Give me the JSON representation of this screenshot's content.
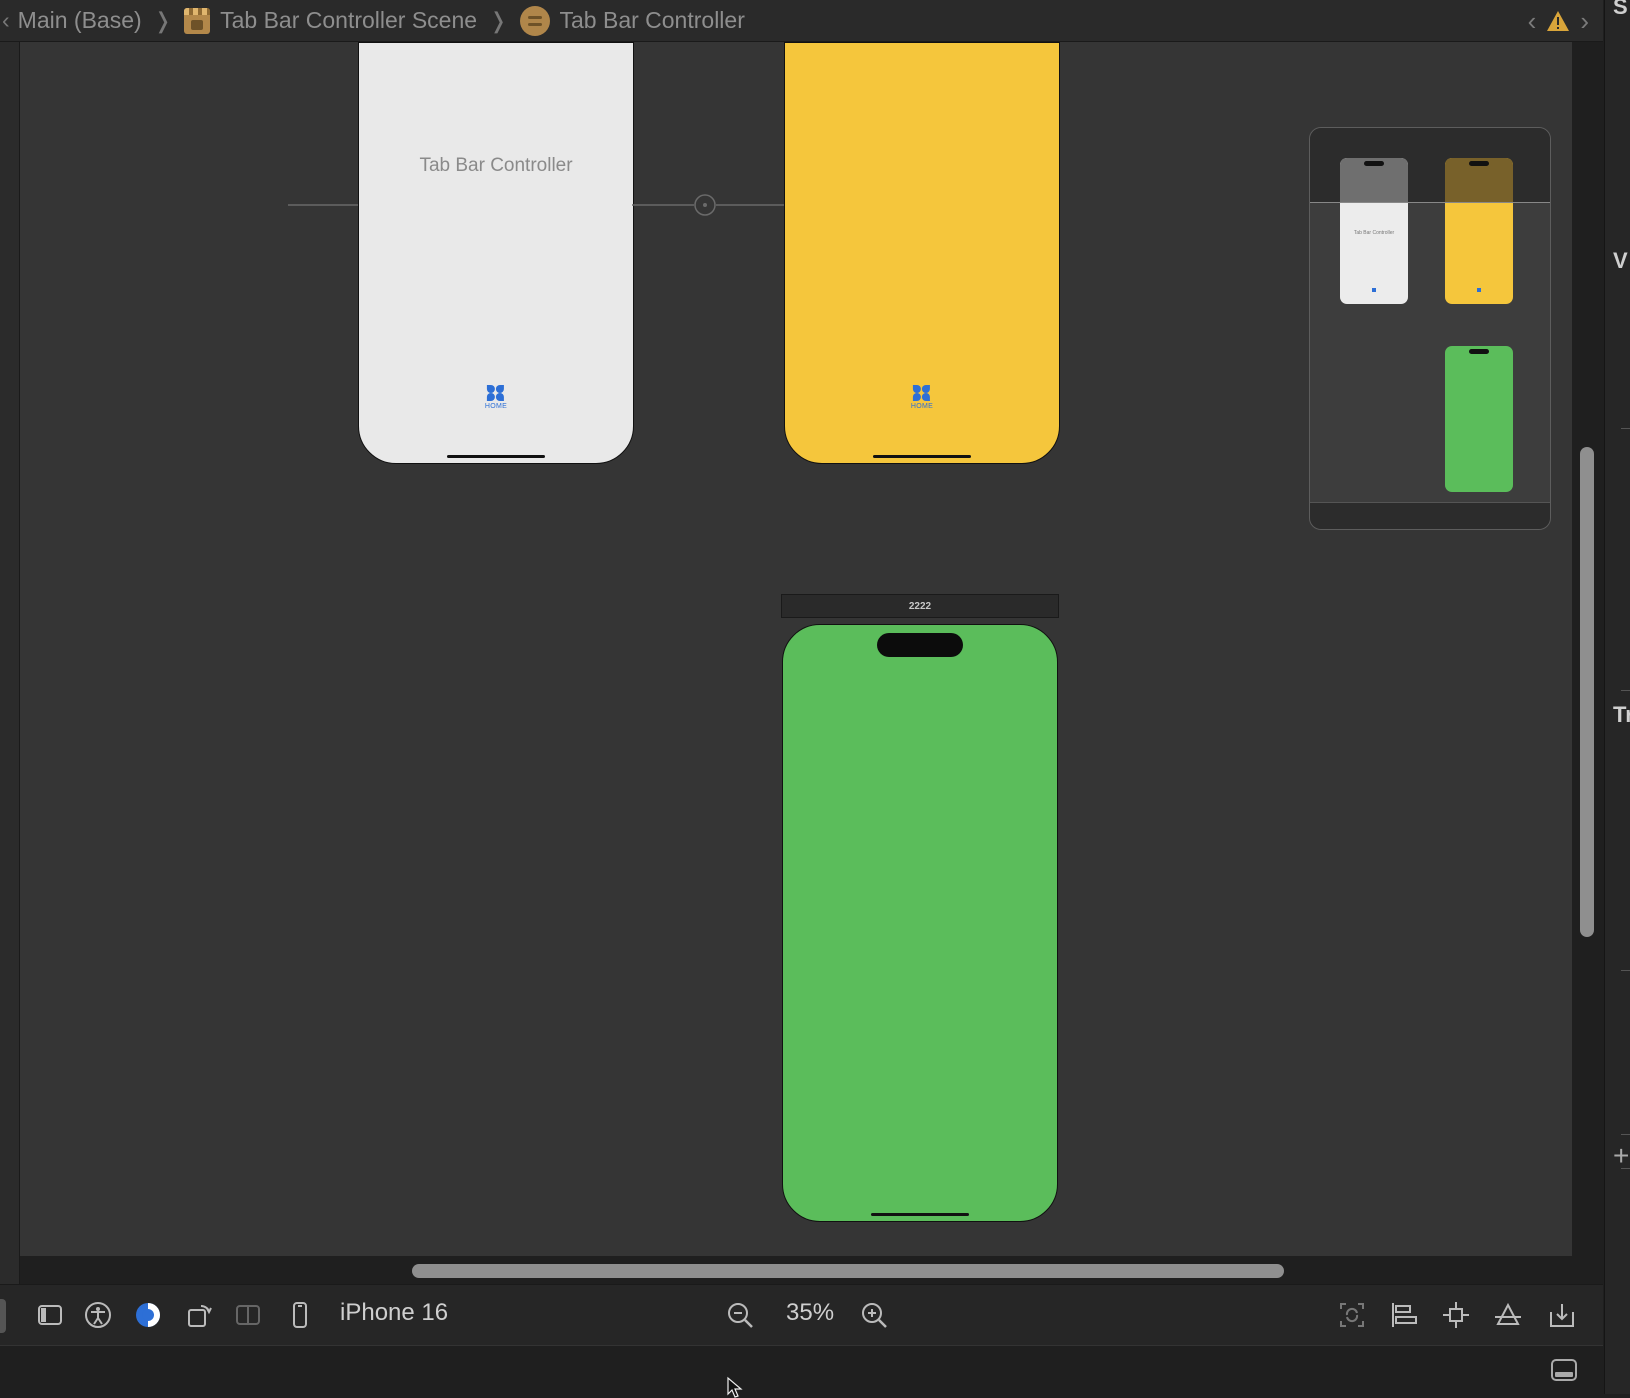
{
  "breadcrumb": {
    "items": [
      {
        "label": "Main (Base)"
      },
      {
        "label": "Tab Bar Controller Scene"
      },
      {
        "label": "Tab Bar Controller"
      }
    ],
    "separator": "❭"
  },
  "canvas": {
    "tab_bar_controller": {
      "title": "Tab Bar Controller",
      "tab_label": "HOME"
    },
    "yellow_controller": {
      "tab_label": "HOME",
      "color": "#f5c63c"
    },
    "green_controller": {
      "scene_title": "2222",
      "color": "#5bbd5b"
    }
  },
  "minimap": {
    "tbc_text": "Tab Bar Controller"
  },
  "toolbar": {
    "device": "iPhone 16",
    "zoom": "35%"
  },
  "inspector": {
    "letters": [
      "S",
      "V",
      "Tr"
    ]
  },
  "colors": {
    "accent": "#2d6fd6",
    "warning": "#d9a53a"
  }
}
